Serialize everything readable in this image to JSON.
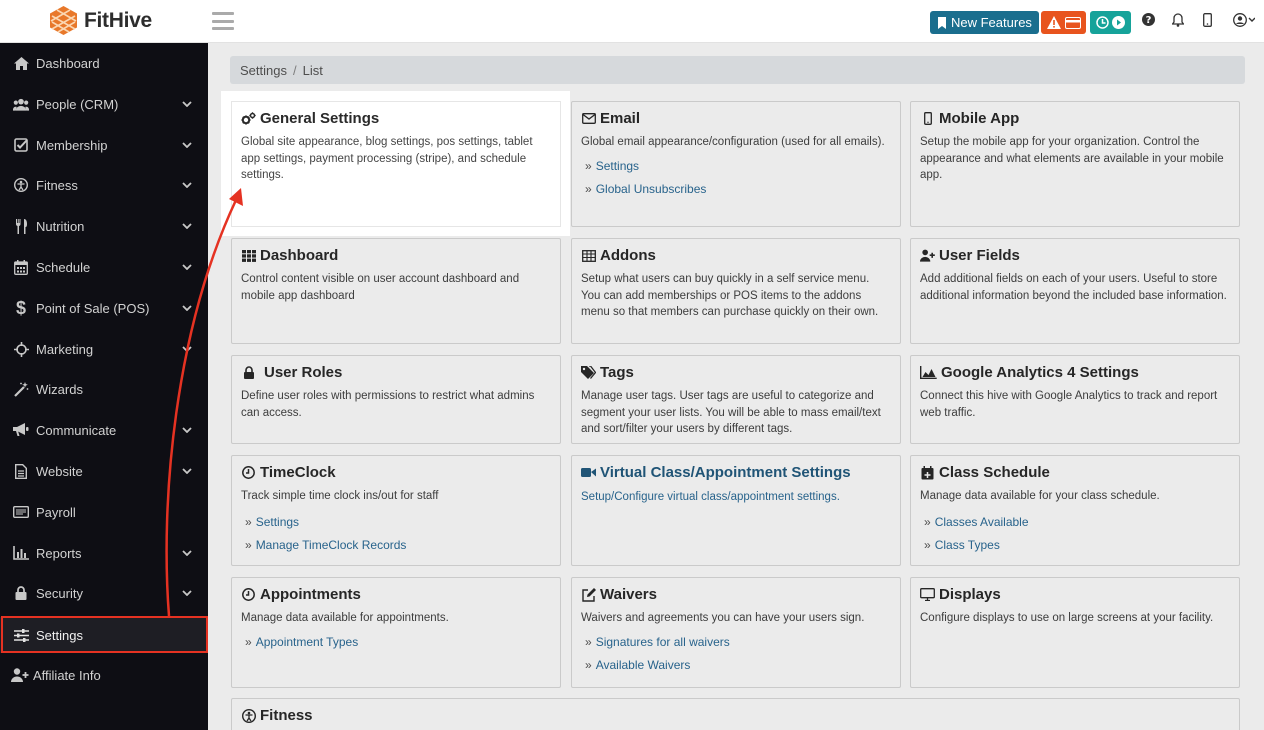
{
  "app": {
    "logo_text": "FitHive",
    "new_features_label": "New Features"
  },
  "sidebar": {
    "items": [
      {
        "label": "Dashboard",
        "icon": "home-icon",
        "chevron": false
      },
      {
        "label": "People (CRM)",
        "icon": "users-icon",
        "chevron": true
      },
      {
        "label": "Membership",
        "icon": "check-square-icon",
        "chevron": true
      },
      {
        "label": "Fitness",
        "icon": "fitness-icon",
        "chevron": true
      },
      {
        "label": "Nutrition",
        "icon": "utensils-icon",
        "chevron": true
      },
      {
        "label": "Schedule",
        "icon": "calendar-icon",
        "chevron": true
      },
      {
        "label": "Point of Sale (POS)",
        "icon": "dollar-icon",
        "chevron": true
      },
      {
        "label": "Marketing",
        "icon": "crosshair-icon",
        "chevron": true
      },
      {
        "label": "Wizards",
        "icon": "magic-wand-icon",
        "chevron": false
      },
      {
        "label": "Communicate",
        "icon": "bullhorn-icon",
        "chevron": true
      },
      {
        "label": "Website",
        "icon": "file-icon",
        "chevron": true
      },
      {
        "label": "Payroll",
        "icon": "money-icon",
        "chevron": false
      },
      {
        "label": "Reports",
        "icon": "bar-chart-icon",
        "chevron": true
      },
      {
        "label": "Security",
        "icon": "lock-icon",
        "chevron": true
      },
      {
        "label": "Settings",
        "icon": "sliders-icon",
        "chevron": false
      },
      {
        "label": "Affiliate Info",
        "icon": "user-plus-icon",
        "chevron": false
      }
    ],
    "active": "Settings"
  },
  "breadcrumb": {
    "items": [
      "Settings",
      "List"
    ]
  },
  "cards": {
    "general": {
      "title": "General Settings",
      "desc": "Global site appearance, blog settings, pos settings, tablet app settings, payment processing (stripe), and schedule settings."
    },
    "email": {
      "title": "Email",
      "desc": "Global email appearance/configuration (used for all emails).",
      "links": [
        "Settings",
        "Global Unsubscribes"
      ]
    },
    "mobile": {
      "title": "Mobile App",
      "desc": "Setup the mobile app for your organization. Control the appearance and what elements are available in your mobile app."
    },
    "dashboard": {
      "title": "Dashboard",
      "desc": "Control content visible on user account dashboard and mobile app dashboard"
    },
    "addons": {
      "title": "Addons",
      "desc": "Setup what users can buy quickly in a self service menu. You can add memberships or POS items to the addons menu so that members can purchase quickly on their own."
    },
    "userfields": {
      "title": "User Fields",
      "desc": "Add additional fields on each of your users. Useful to store additional information beyond the included base information."
    },
    "roles": {
      "title": "User Roles",
      "desc": "Define user roles with permissions to restrict what admins can access."
    },
    "tags": {
      "title": "Tags",
      "desc": "Manage user tags. User tags are useful to categorize and segment your user lists. You will be able to mass email/text and sort/filter your users by different tags."
    },
    "ga4": {
      "title": "Google Analytics 4 Settings",
      "desc": "Connect this hive with Google Analytics to track and report web traffic."
    },
    "timeclock": {
      "title": "TimeClock",
      "desc": "Track simple time clock ins/out for staff",
      "links": [
        "Settings",
        "Manage TimeClock Records"
      ]
    },
    "virtual": {
      "title": "Virtual Class/Appointment Settings",
      "desc": "Setup/Configure virtual class/appointment settings."
    },
    "classschedule": {
      "title": "Class Schedule",
      "desc": "Manage data available for your class schedule.",
      "links": [
        "Classes Available",
        "Class Types"
      ]
    },
    "appointments": {
      "title": "Appointments",
      "desc": "Manage data available for appointments.",
      "links": [
        "Appointment Types"
      ]
    },
    "waivers": {
      "title": "Waivers",
      "desc": "Waivers and agreements you can have your users sign.",
      "links": [
        "Signatures for all waivers",
        "Available Waivers"
      ]
    },
    "displays": {
      "title": "Displays",
      "desc": "Configure displays to use on large screens at your facility."
    },
    "fitness": {
      "title": "Fitness"
    }
  },
  "colors": {
    "sidebar_bg": "#0e0e14",
    "new_features": "#1a6e8e",
    "alert": "#e8541e",
    "clock": "#16a39a",
    "highlight": "#e53222",
    "link": "#2c6c98"
  }
}
